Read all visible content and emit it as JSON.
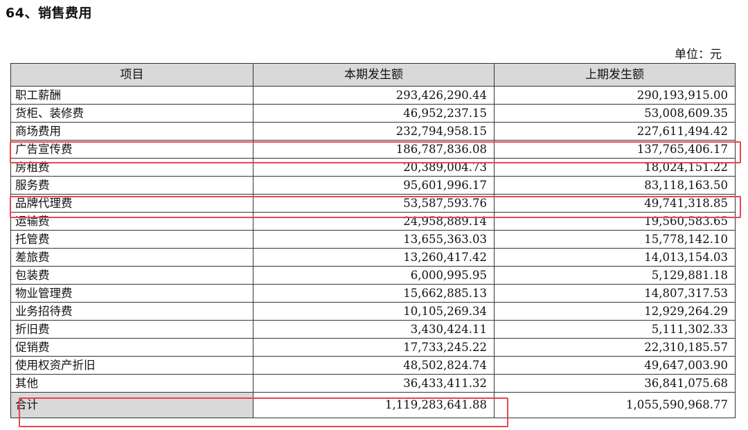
{
  "title": "64、销售费用",
  "unit_label": "单位：元",
  "headers": [
    "项目",
    "本期发生额",
    "上期发生额"
  ],
  "rows": [
    {
      "name": "职工薪酬",
      "current": "293,426,290.44",
      "previous": "290,193,915.00"
    },
    {
      "name": "货柜、装修费",
      "current": "46,952,237.15",
      "previous": "53,008,609.35"
    },
    {
      "name": "商场费用",
      "current": "232,794,958.15",
      "previous": "227,611,494.42"
    },
    {
      "name": "广告宣传费",
      "current": "186,787,836.08",
      "previous": "137,765,406.17"
    },
    {
      "name": "房租费",
      "current": "20,389,004.73",
      "previous": "18,024,151.22"
    },
    {
      "name": "服务费",
      "current": "95,601,996.17",
      "previous": "83,118,163.50"
    },
    {
      "name": "品牌代理费",
      "current": "53,587,593.76",
      "previous": "49,741,318.85"
    },
    {
      "name": "运输费",
      "current": "24,958,889.14",
      "previous": "19,560,583.65"
    },
    {
      "name": "托管费",
      "current": "13,655,363.03",
      "previous": "15,778,142.10"
    },
    {
      "name": "差旅费",
      "current": "13,260,417.42",
      "previous": "14,013,154.03"
    },
    {
      "name": "包装费",
      "current": "6,000,995.95",
      "previous": "5,129,881.18"
    },
    {
      "name": "物业管理费",
      "current": "15,662,885.13",
      "previous": "14,807,317.53"
    },
    {
      "name": "业务招待费",
      "current": "10,105,269.34",
      "previous": "12,929,264.29"
    },
    {
      "name": "折旧费",
      "current": "3,430,424.11",
      "previous": "5,111,302.33"
    },
    {
      "name": "促销费",
      "current": "17,733,245.22",
      "previous": "22,310,185.57"
    },
    {
      "name": "使用权资产折旧",
      "current": "48,502,824.74",
      "previous": "49,647,003.90"
    },
    {
      "name": "其他",
      "current": "36,433,411.32",
      "previous": "36,841,075.68"
    }
  ],
  "total": {
    "name": "合计",
    "current": "1,119,283,641.88",
    "previous": "1,055,590,968.77"
  },
  "highlight_color": "#e8454d"
}
